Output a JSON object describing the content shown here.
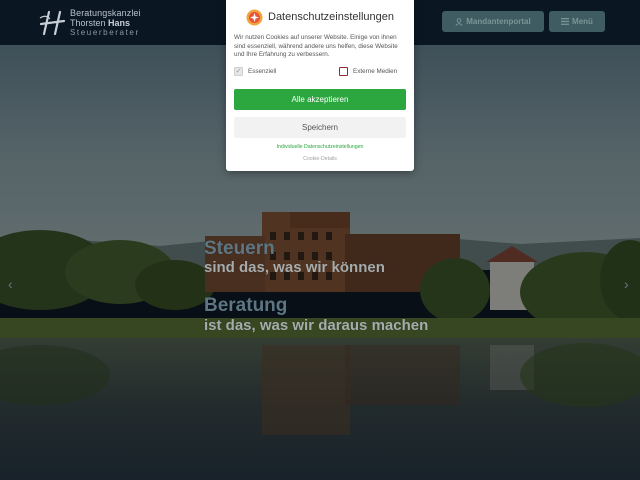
{
  "header": {
    "logo": {
      "line1": "Beratungskanzlei",
      "line2_regular": "Thorsten ",
      "line2_bold": "Hans",
      "line3": "Steuerberater"
    },
    "portal_button": {
      "label": "Mandantenportal",
      "icon": "user-icon"
    },
    "menu_button": {
      "label": "Menü",
      "icon": "hamburger-icon"
    }
  },
  "hero": {
    "line1": "Steuern",
    "line2": "sind das, was wir können",
    "line3": "Beratung",
    "line4": "ist das, was wir daraus machen",
    "prev_arrow": "‹",
    "next_arrow": "›"
  },
  "cookie_dialog": {
    "title": "Datenschutzeinstellungen",
    "icon": "borlabs-cookie-icon",
    "text": "Wir nutzen Cookies auf unserer Website. Einige von ihnen sind essenziell, während andere uns helfen, diese Website und Ihre Erfahrung zu verbessern.",
    "checkboxes": [
      {
        "label": "Essenziell",
        "checked": true,
        "disabled": true
      },
      {
        "label": "Externe Medien",
        "checked": false,
        "disabled": false
      }
    ],
    "accept_all_label": "Alle akzeptieren",
    "save_label": "Speichern",
    "individual_link": "Individuelle Datenschutzeinstellungen",
    "details_link": "Cookie-Details"
  },
  "colors": {
    "header_bg": "#0a1622",
    "header_button_bg": "#3f5c62",
    "accept_green": "#2ca63f",
    "external_media_border": "#9c2a2a"
  }
}
